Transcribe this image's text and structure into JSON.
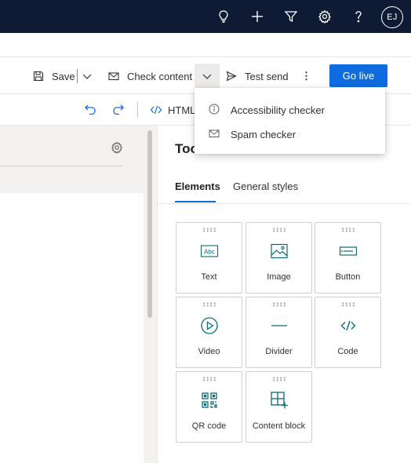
{
  "topbar": {
    "icons": [
      "lightbulb-icon",
      "plus-icon",
      "filter-icon",
      "gear-icon",
      "help-icon"
    ],
    "avatar_initials": "EJ",
    "background": "#0f1b35"
  },
  "command_bar": {
    "save_label": "Save",
    "check_content_label": "Check content",
    "test_send_label": "Test send",
    "more_label": "⋮",
    "go_live_label": "Go live",
    "accent": "#0f6cde"
  },
  "sub_toolbar": {
    "html_label": "HTML"
  },
  "dropdown": {
    "items": [
      {
        "icon": "info-circle-icon",
        "label": "Accessibility checker"
      },
      {
        "icon": "mail-icon",
        "label": "Spam checker"
      }
    ]
  },
  "toolbox": {
    "title": "Toolbox",
    "tabs": [
      {
        "label": "Elements",
        "active": true
      },
      {
        "label": "General styles",
        "active": false
      }
    ],
    "elements": [
      {
        "label": "Text",
        "icon": "text-abc-icon"
      },
      {
        "label": "Image",
        "icon": "image-icon"
      },
      {
        "label": "Button",
        "icon": "button-icon"
      },
      {
        "label": "Video",
        "icon": "video-play-icon"
      },
      {
        "label": "Divider",
        "icon": "divider-icon"
      },
      {
        "label": "Code",
        "icon": "code-icon"
      },
      {
        "label": "QR code",
        "icon": "qr-code-icon"
      },
      {
        "label": "Content block",
        "icon": "content-block-icon"
      }
    ],
    "icon_color": "#0b6a77"
  }
}
